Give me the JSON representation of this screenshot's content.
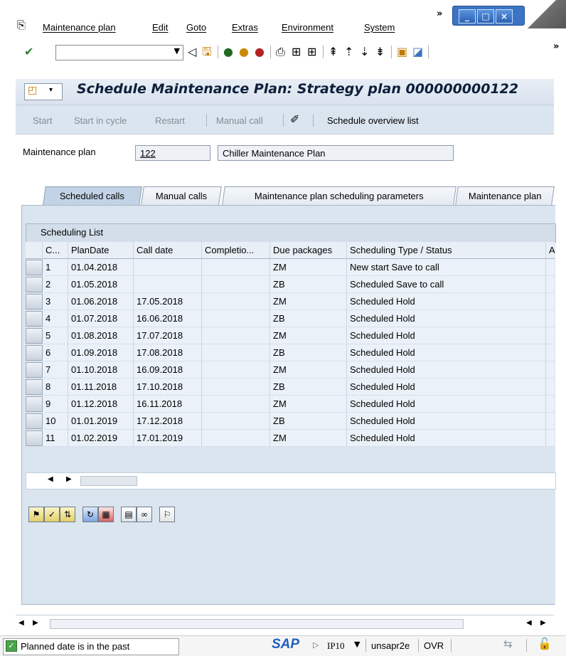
{
  "menu": {
    "items": [
      "Maintenance plan",
      "Edit",
      "Goto",
      "Extras",
      "Environment",
      "System"
    ]
  },
  "toolbar": {
    "command_value": ""
  },
  "title": {
    "text": "Schedule Maintenance Plan: Strategy plan 000000000122"
  },
  "app_toolbar": {
    "start": "Start",
    "start_in_cycle": "Start in cycle",
    "restart": "Restart",
    "manual_call": "Manual call",
    "schedule_overview": "Schedule overview list"
  },
  "header": {
    "label": "Maintenance plan",
    "plan_number": "122",
    "plan_description": "Chiller Maintenance Plan"
  },
  "tabs": [
    {
      "label": "Scheduled calls"
    },
    {
      "label": "Manual calls"
    },
    {
      "label": "Maintenance plan scheduling parameters"
    },
    {
      "label": "Maintenance plan"
    }
  ],
  "table": {
    "title": "Scheduling List",
    "columns": [
      "C...",
      "PlanDate",
      "Call date",
      "Completio...",
      "Due packages",
      "Scheduling Type / Status",
      "A"
    ],
    "rows": [
      {
        "c": "1",
        "plan_date": "01.04.2018",
        "call_date": "",
        "completion": "",
        "due": "ZM",
        "status": "New start  Save to call"
      },
      {
        "c": "2",
        "plan_date": "01.05.2018",
        "call_date": "",
        "completion": "",
        "due": "ZB",
        "status": "Scheduled  Save to call"
      },
      {
        "c": "3",
        "plan_date": "01.06.2018",
        "call_date": "17.05.2018",
        "completion": "",
        "due": "ZM",
        "status": "Scheduled  Hold"
      },
      {
        "c": "4",
        "plan_date": "01.07.2018",
        "call_date": "16.06.2018",
        "completion": "",
        "due": "ZB",
        "status": "Scheduled  Hold"
      },
      {
        "c": "5",
        "plan_date": "01.08.2018",
        "call_date": "17.07.2018",
        "completion": "",
        "due": "ZM",
        "status": "Scheduled  Hold"
      },
      {
        "c": "6",
        "plan_date": "01.09.2018",
        "call_date": "17.08.2018",
        "completion": "",
        "due": "ZB",
        "status": "Scheduled  Hold"
      },
      {
        "c": "7",
        "plan_date": "01.10.2018",
        "call_date": "16.09.2018",
        "completion": "",
        "due": "ZM",
        "status": "Scheduled  Hold"
      },
      {
        "c": "8",
        "plan_date": "01.11.2018",
        "call_date": "17.10.2018",
        "completion": "",
        "due": "ZB",
        "status": "Scheduled  Hold"
      },
      {
        "c": "9",
        "plan_date": "01.12.2018",
        "call_date": "16.11.2018",
        "completion": "",
        "due": "ZM",
        "status": "Scheduled  Hold"
      },
      {
        "c": "10",
        "plan_date": "01.01.2019",
        "call_date": "17.12.2018",
        "completion": "",
        "due": "ZB",
        "status": "Scheduled  Hold"
      },
      {
        "c": "11",
        "plan_date": "01.02.2019",
        "call_date": "17.01.2019",
        "completion": "",
        "due": "ZM",
        "status": "Scheduled  Hold"
      }
    ]
  },
  "status_bar": {
    "message": "Planned date is in the past",
    "logo": "SAP",
    "system": "IP10",
    "server": "unsapr2e",
    "mode": "OVR"
  },
  "colors": {
    "accent_blue": "#3a74c4",
    "panel_bg": "#dbe5f0",
    "sap_logo": "#1f5fbf"
  }
}
